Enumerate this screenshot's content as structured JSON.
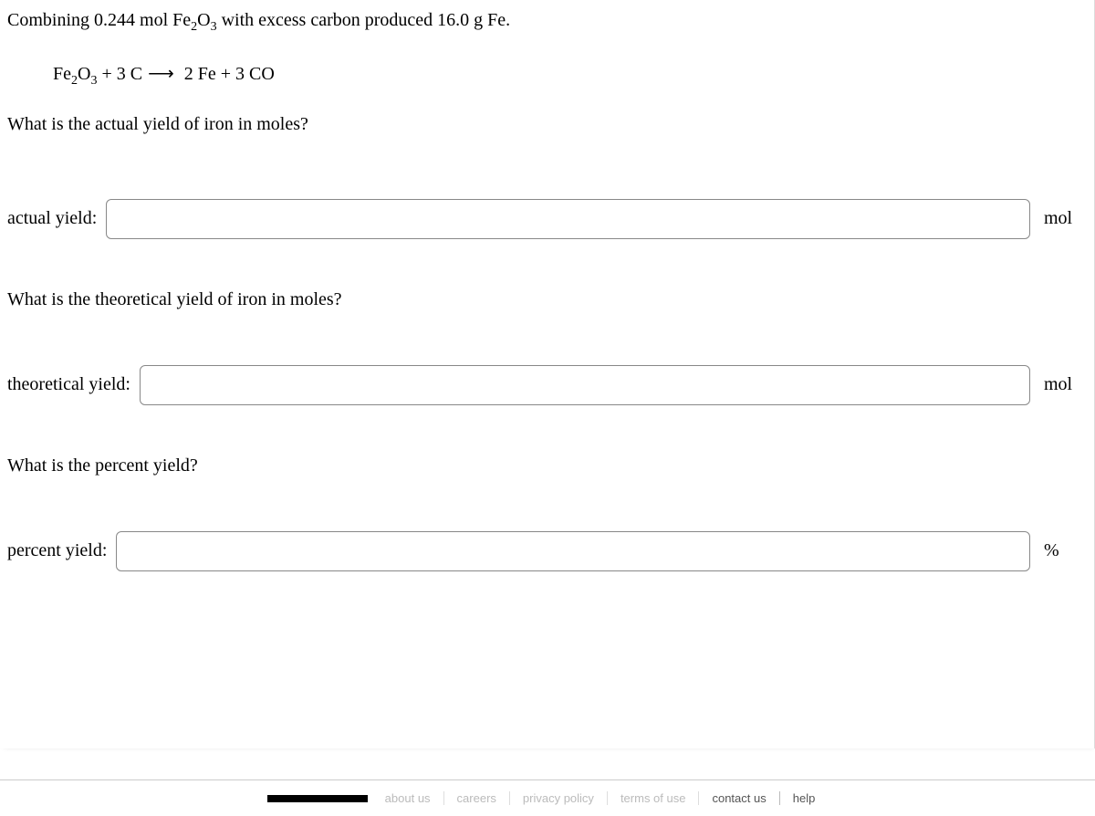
{
  "problem": {
    "intro_prefix": "Combining 0.244 mol Fe",
    "intro_sub1": "2",
    "intro_mid": "O",
    "intro_sub2": "3",
    "intro_suffix": " with excess carbon produced 16.0 g Fe.",
    "eq_part1": "Fe",
    "eq_sub1": "2",
    "eq_part2": "O",
    "eq_sub2": "3",
    "eq_part3": " + 3 C",
    "eq_arrow": "⟶",
    "eq_part4": " 2 Fe + 3 CO"
  },
  "questions": {
    "q1": "What is the actual yield of iron in moles?",
    "q2": "What is the theoretical yield of iron in moles?",
    "q3": "What is the percent yield?"
  },
  "inputs": {
    "actual_label": "actual yield:",
    "actual_unit": "mol",
    "theoretical_label": "theoretical yield:",
    "theoretical_unit": "mol",
    "percent_label": "percent yield:",
    "percent_unit": "%"
  },
  "footer": {
    "contact": "contact us",
    "help": "help"
  }
}
